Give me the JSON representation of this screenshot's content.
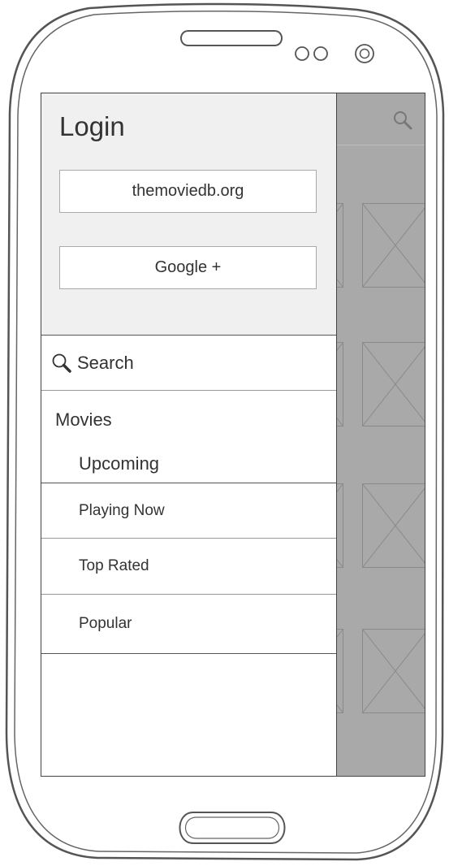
{
  "drawer": {
    "login_title": "Login",
    "login_buttons": [
      "themoviedb.org",
      "Google +"
    ],
    "search_label": "Search",
    "section_header": "Movies",
    "menu_items": [
      "Upcoming",
      "Playing Now",
      "Top Rated",
      "Popular"
    ]
  },
  "icons": {
    "search": "search-icon",
    "toolbar_search": "search-icon",
    "placeholder": "image-placeholder-icon"
  },
  "colors": {
    "login_panel_bg": "#f0f0f0",
    "drawer_bg": "#ffffff",
    "scrim": "#a9a9a9"
  }
}
